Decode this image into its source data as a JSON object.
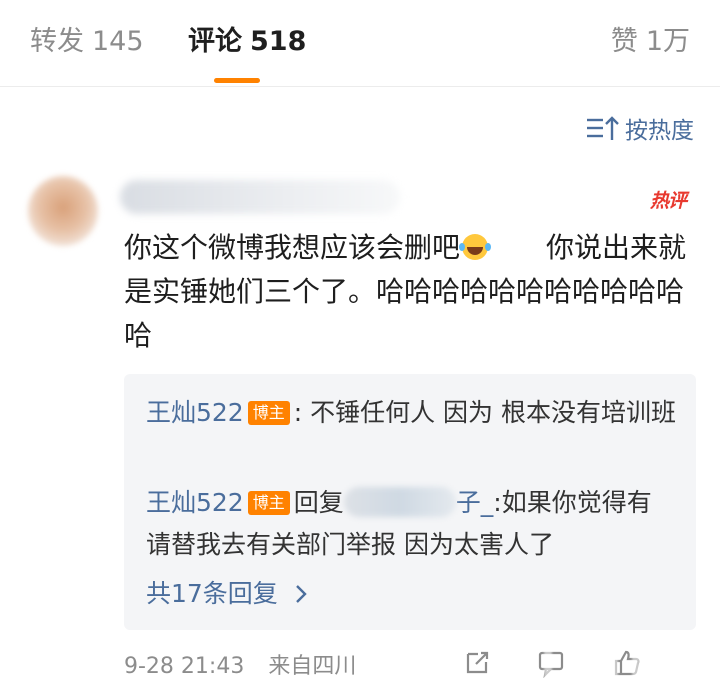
{
  "tabs": {
    "repost_label": "转发",
    "repost_count": "145",
    "comments_label": "评论",
    "comments_count": "518",
    "likes_label": "赞",
    "likes_count": "1万"
  },
  "sort": {
    "label": "按热度"
  },
  "comment": {
    "badge": "热评",
    "text_part1": "你这个微博我想应该会删吧",
    "text_part2": "你说出来就是实锤她们三个了。哈哈哈哈哈哈哈哈哈哈哈哈",
    "timestamp": "9-28 21:43",
    "location": "来自四川"
  },
  "replies": [
    {
      "user": "王灿522",
      "tag": "博主",
      "text": ":  不锤任何人 因为 根本没有培训班"
    },
    {
      "user": "王灿522",
      "tag": "博主",
      "prefix": "回复",
      "mention_tail": "子_",
      "text": ":如果你觉得有 请替我去有关部门举报 因为太害人了"
    }
  ],
  "more_replies": "共17条回复",
  "icons": {
    "sort": "sort-icon",
    "emoji": "laughing-tears-emoji-icon",
    "chevron": "chevron-right-icon",
    "repost": "repost-icon",
    "reply": "reply-icon",
    "like": "like-icon",
    "accent": "#ff8200",
    "link": "#4a6d9c",
    "hot": "#e8392f"
  }
}
